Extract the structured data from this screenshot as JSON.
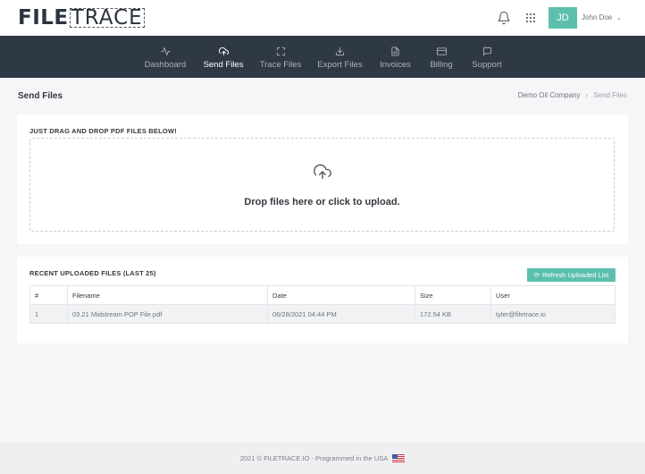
{
  "brand": {
    "logo_part1": "FILE",
    "logo_part2": "TRACE"
  },
  "header": {
    "avatar_initials": "JD",
    "user_name": "John Doe",
    "chevron": "⌄",
    "avatar_color": "#5cbfae"
  },
  "nav": {
    "items": [
      {
        "label": "Dashboard",
        "icon": "activity-icon"
      },
      {
        "label": "Send Files",
        "icon": "cloud-upload-icon",
        "active": true
      },
      {
        "label": "Trace Files",
        "icon": "maximize-icon"
      },
      {
        "label": "Export Files",
        "icon": "download-icon"
      },
      {
        "label": "Invoices",
        "icon": "file-text-icon"
      },
      {
        "label": "Billing",
        "icon": "credit-card-icon"
      },
      {
        "label": "Support",
        "icon": "message-square-icon"
      }
    ]
  },
  "page": {
    "title": "Send Files",
    "breadcrumb": {
      "root": "Demo Oil Company",
      "separator": "›",
      "current": "Send Files"
    }
  },
  "upload": {
    "heading": "JUST DRAG AND DROP PDF FILES BELOW!",
    "drop_text": "Drop files here or click to upload."
  },
  "recent": {
    "heading": "RECENT UPLOADED FILES (LAST 25)",
    "refresh_icon": "⟳",
    "refresh_label": "Refresh Uploaded List",
    "columns": [
      "#",
      "Filename",
      "Date",
      "Size",
      "User"
    ],
    "rows": [
      [
        "1",
        "03.21 Midstream POP File.pdf",
        "06/28/2021 04:44 PM",
        "172.54 KB",
        "tyler@filetrace.io"
      ]
    ]
  },
  "footer": {
    "text": "2021 © FILETRACE.IO - Programmed in the USA"
  }
}
